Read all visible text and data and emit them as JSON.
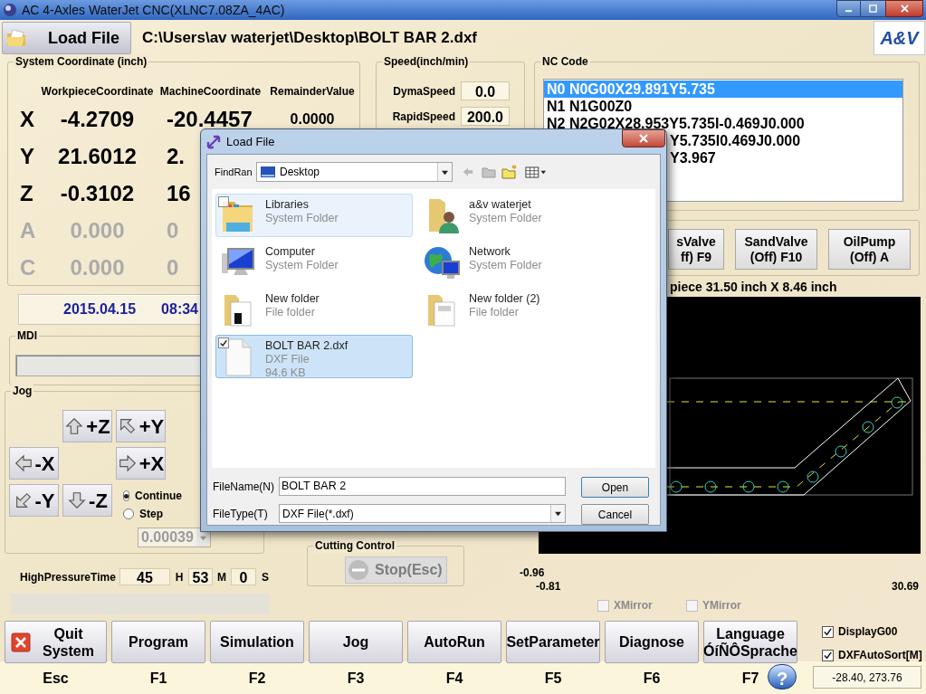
{
  "window": {
    "title": "AC 4-Axles WaterJet CNC(XLNC7.08ZA_4AC)"
  },
  "header": {
    "load_button": "Load File",
    "file_path": "C:\\Users\\av waterjet\\Desktop\\BOLT BAR 2.dxf",
    "logo": "A&V"
  },
  "coordinates": {
    "title": "System Coordinate (inch)",
    "columns": [
      "WorkpieceCoordinate",
      "MachineCoordinate",
      "RemainderValue"
    ],
    "rows": [
      {
        "axis": "X",
        "workpiece": "-4.2709",
        "machine": "-20.4457",
        "remainder": "0.0000",
        "disabled": false
      },
      {
        "axis": "Y",
        "workpiece": "21.6012",
        "machine": "2.",
        "disabled": false
      },
      {
        "axis": "Z",
        "workpiece": "-0.3102",
        "machine": "16",
        "disabled": false
      },
      {
        "axis": "A",
        "workpiece": "0.000",
        "machine": "0",
        "disabled": true
      },
      {
        "axis": "C",
        "workpiece": "0.000",
        "machine": "0",
        "disabled": true
      }
    ]
  },
  "speed": {
    "title": "Speed(inch/min)",
    "rows": [
      {
        "label": "DymaSpeed",
        "value": "0.0"
      },
      {
        "label": "RapidSpeed",
        "value": "200.0"
      }
    ]
  },
  "clock": {
    "date": "2015.04.15",
    "time": "08:34"
  },
  "mdi": {
    "title": "MDI"
  },
  "jog": {
    "title": "Jog",
    "buttons": [
      {
        "label": "+Z",
        "kind": "up"
      },
      {
        "label": "+Y",
        "kind": "up-left"
      },
      {
        "label": "-X",
        "kind": "left"
      },
      {
        "label": "+X",
        "kind": "right"
      },
      {
        "label": "-Y",
        "kind": "down-left"
      },
      {
        "label": "-Z",
        "kind": "down"
      }
    ],
    "modes": [
      {
        "label": "Continue",
        "selected": true
      },
      {
        "label": "Step",
        "selected": false
      }
    ],
    "step_value": "0.00039"
  },
  "high_pressure_time": {
    "label": "HighPressureTime",
    "hours": "45",
    "hours_unit": "H",
    "minutes": "53",
    "minutes_unit": "M",
    "seconds": "0",
    "seconds_unit": "S"
  },
  "cutting_control": {
    "title": "Cutting Control",
    "stop_button": "Stop(Esc)",
    "disabled": true
  },
  "nc_code": {
    "title": "NC Code",
    "lines": [
      {
        "text": "N0 N0G00X29.891Y5.735",
        "selected": true,
        "clipped": false
      },
      {
        "text": "N1 N1G00Z0",
        "selected": false,
        "clipped": false
      },
      {
        "text": "N2 N2G02X28.953Y5.735I-0.469J0.000",
        "selected": false,
        "clipped": false
      },
      {
        "text": "Y5.735I0.469J0.000",
        "selected": false,
        "clipped": true
      },
      {
        "text": "Y3.967",
        "selected": false,
        "clipped": true
      }
    ]
  },
  "valves": [
    {
      "label": "sValve",
      "state": "ff) F9"
    },
    {
      "label": "SandValve",
      "state": "(Off) F10"
    },
    {
      "label": "OilPump",
      "state": "(Off) A"
    }
  ],
  "workpiece_size": "piece 31.50 inch X 8.46 inch",
  "preview": {
    "y_min": "-0.96",
    "x_min": "-0.81",
    "x_max": "30.69"
  },
  "mirrors": [
    {
      "label": "XMirror",
      "checked": false
    },
    {
      "label": "YMirror",
      "checked": false
    }
  ],
  "function_keys": [
    {
      "label": "Quit System",
      "key": "Esc",
      "kind": "quit"
    },
    {
      "label": "Program",
      "key": "F1",
      "kind": "plain"
    },
    {
      "label": "Simulation",
      "key": "F2",
      "kind": "plain"
    },
    {
      "label": "Jog",
      "key": "F3",
      "kind": "plain"
    },
    {
      "label": "AutoRun",
      "key": "F4",
      "kind": "plain"
    },
    {
      "label": "SetParameter",
      "key": "F5",
      "kind": "plain"
    },
    {
      "label": "Diagnose",
      "key": "F6",
      "kind": "plain"
    },
    {
      "label": "Language ÓíÑÔSprache",
      "key": "F7",
      "kind": "plain"
    }
  ],
  "help_button": "?",
  "options": [
    {
      "label": "DisplayG00",
      "checked": true
    },
    {
      "label": "DXFAutoSort[M]",
      "checked": true
    }
  ],
  "cursor_position": "-28.40, 273.76",
  "dialog": {
    "title": "Load File",
    "find_range_label": "FindRan",
    "location": "Desktop",
    "items": [
      {
        "name": "Libraries",
        "type": "System Folder",
        "kind": "libraries",
        "selected": false,
        "hovered": true
      },
      {
        "name": "a&v waterjet",
        "type": "System Folder",
        "kind": "user",
        "selected": false,
        "hovered": false
      },
      {
        "name": "Computer",
        "type": "System Folder",
        "kind": "computer",
        "selected": false,
        "hovered": false
      },
      {
        "name": "Network",
        "type": "System Folder",
        "kind": "network",
        "selected": false,
        "hovered": false
      },
      {
        "name": "New folder",
        "type": "File folder",
        "kind": "folder-docs",
        "selected": false,
        "hovered": false
      },
      {
        "name": "New folder (2)",
        "type": "File folder",
        "kind": "folder-pages",
        "selected": false,
        "hovered": false
      },
      {
        "name": "BOLT BAR 2.dxf",
        "type": "DXF File",
        "size": "94.6 KB",
        "kind": "file",
        "selected": true,
        "hovered": false
      }
    ],
    "file_name_label": "FileName(N)",
    "file_name": "BOLT BAR 2",
    "file_type_label": "FileType(T)",
    "file_type": "DXF File(*.dxf)",
    "buttons": [
      "Open",
      "Cancel"
    ]
  }
}
